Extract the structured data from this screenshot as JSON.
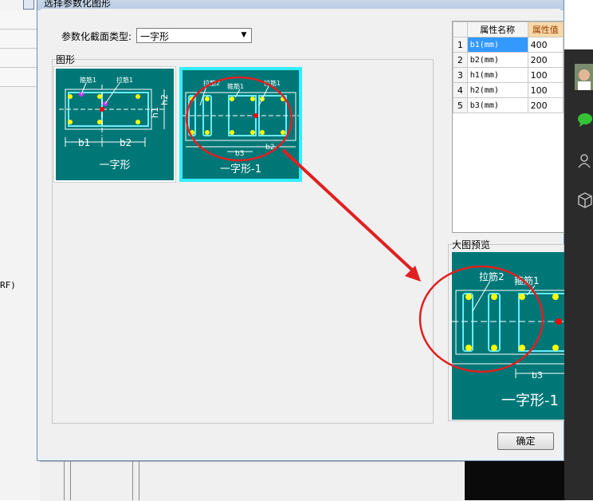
{
  "dialog": {
    "title": "选择参数化图形",
    "section_type_label": "参数化截面类型:",
    "section_type_value": "一字形",
    "shapes_group_label": "图形",
    "preview_group_label": "大图预览",
    "ok_label": "确定"
  },
  "thumbnails": [
    {
      "caption": "一字形",
      "labels": {
        "stirrup": "箍筋1",
        "tie": "拉筋1",
        "b1": "b1",
        "b2": "b2",
        "h1": "h1",
        "h2": "h2"
      }
    },
    {
      "caption": "一字形-1",
      "labels": {
        "tie2": "拉筋2",
        "stirrup": "箍筋1",
        "tie1": "拉筋1",
        "b3": "b3",
        "b2": "b2"
      }
    }
  ],
  "preview": {
    "caption": "一字形-1",
    "labels": {
      "tie2": "拉筋2",
      "stirrup": "箍筋1",
      "b3": "b3"
    }
  },
  "property_table": {
    "headers": [
      "",
      "属性名称",
      "属性值"
    ],
    "rows": [
      {
        "index": "1",
        "name": "b1(mm)",
        "value": "400"
      },
      {
        "index": "2",
        "name": "b2(mm)",
        "value": "200"
      },
      {
        "index": "3",
        "name": "h1(mm)",
        "value": "100"
      },
      {
        "index": "4",
        "name": "h2(mm)",
        "value": "100"
      },
      {
        "index": "5",
        "name": "b3(mm)",
        "value": "200"
      }
    ]
  },
  "background": {
    "left_text": "RF)"
  },
  "colors": {
    "shape_bg": "#007777",
    "rebar": "#66eeff",
    "bar_dot": "#ffff00",
    "annotation": "#e02020",
    "selected_row": "#3399ff"
  },
  "icons": [
    "chat-icon",
    "contacts-icon",
    "box-icon",
    "dropdown-arrow-icon"
  ]
}
